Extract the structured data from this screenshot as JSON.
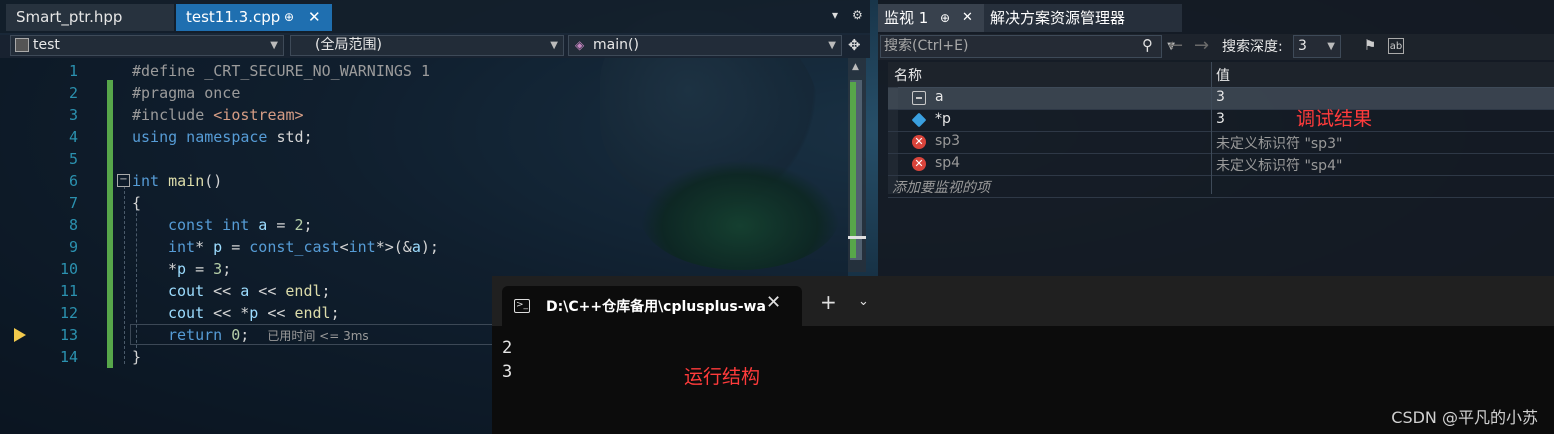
{
  "editor_tabs": {
    "inactive": {
      "label": "Smart_ptr.hpp"
    },
    "active": {
      "label": "test11.3.cpp",
      "pin": "⊕",
      "close": "✕"
    },
    "dropdown": "▾",
    "settings": "⚙"
  },
  "navbar": {
    "project": "test",
    "scope": "(全局范围)",
    "member": "main()",
    "split": "✥"
  },
  "code": {
    "lines": [
      {
        "n": "1"
      },
      {
        "n": "2"
      },
      {
        "n": "3"
      },
      {
        "n": "4"
      },
      {
        "n": "5"
      },
      {
        "n": "6"
      },
      {
        "n": "7"
      },
      {
        "n": "8"
      },
      {
        "n": "9"
      },
      {
        "n": "10"
      },
      {
        "n": "11"
      },
      {
        "n": "12"
      },
      {
        "n": "13"
      },
      {
        "n": "14"
      }
    ],
    "l1": {
      "kw": "#define",
      "rest": " _CRT_SECURE_NO_WARNINGS 1"
    },
    "l2": {
      "kw": "#pragma",
      "rest": " once"
    },
    "l3": {
      "kw": "#include",
      "rest": " <iostream>"
    },
    "l4": {
      "a": "using",
      "b": " namespace",
      "c": " std;"
    },
    "l6": {
      "a": "int",
      "b": " main",
      "c": "()"
    },
    "l7": "{",
    "l8": {
      "a": "const",
      "b": " int",
      "c": " a",
      "d": " = ",
      "e": "2",
      "f": ";"
    },
    "l9": {
      "a": "int",
      "b": "* ",
      "c": "p",
      "d": " = ",
      "e": "const_cast",
      "f": "<",
      "g": "int",
      "h": "*>(&",
      "i": "a",
      "j": ");"
    },
    "l10": {
      "a": "*",
      "b": "p",
      "c": " = ",
      "d": "3",
      "e": ";"
    },
    "l11": {
      "a": "cout",
      "b": " << ",
      "c": "a",
      "d": " << ",
      "e": "endl",
      "f": ";"
    },
    "l12": {
      "a": "cout",
      "b": " << *",
      "c": "p",
      "d": " << ",
      "e": "endl",
      "f": ";"
    },
    "l13": {
      "a": "return",
      "b": " ",
      "c": "0",
      "d": ";",
      "elapsed": "已用时间 <= 3ms"
    },
    "l14": "}",
    "collapse": "−"
  },
  "watch": {
    "tab1": "监视 1",
    "tab1_pin": "⊕",
    "tab1_close": "✕",
    "tab2": "解决方案资源管理器",
    "search_placeholder": "搜索(Ctrl+E)",
    "search_icon": "⚲",
    "back_arrow": "←",
    "forward_arrow": "→",
    "depth_label": "搜索深度:",
    "depth_value": "3",
    "col_name": "名称",
    "col_value": "值",
    "rows": [
      {
        "name": "a",
        "value": "3"
      },
      {
        "name": "*p",
        "value": "3"
      },
      {
        "name": "sp3",
        "value": "未定义标识符 \"sp3\""
      },
      {
        "name": "sp4",
        "value": "未定义标识符 \"sp4\""
      }
    ],
    "add_placeholder": "添加要监视的项",
    "error_glyph": "✕"
  },
  "annotations": {
    "debug_result": "调试结果",
    "run_result": "运行结构"
  },
  "terminal": {
    "title": "D:\\C++仓库备用\\cplusplus-wa",
    "close": "✕",
    "plus": "+",
    "dropdown": "⌄",
    "output": [
      "2",
      "3"
    ]
  },
  "watermark": "CSDN @平凡的小苏",
  "colors": {
    "accent": "#1f6fb0",
    "annotation": "#ff3b3b",
    "change_bar": "#57a64a",
    "line_number": "#2b91af"
  }
}
